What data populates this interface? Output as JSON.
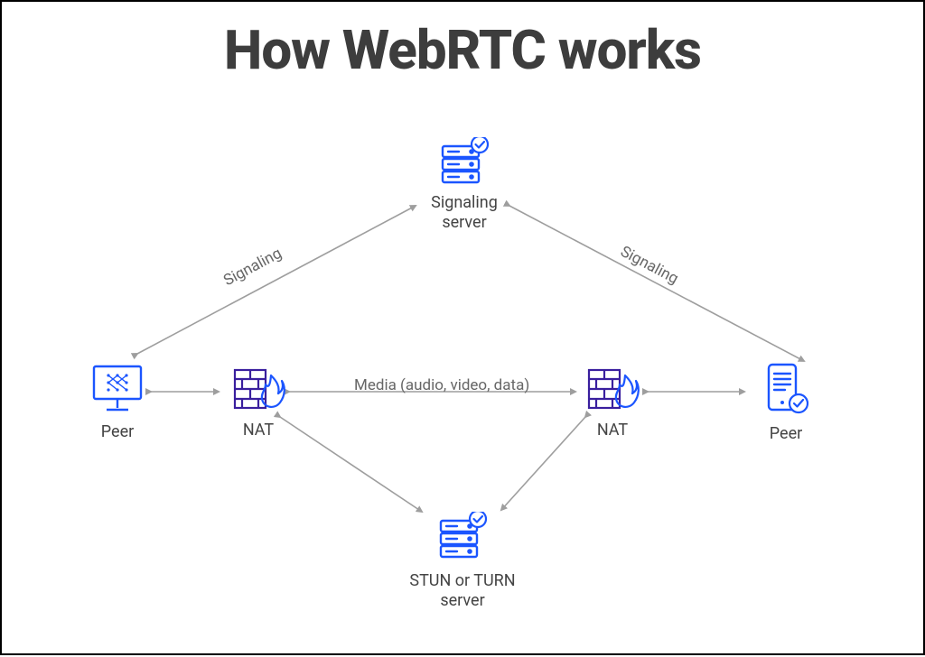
{
  "title": "How WebRTC works",
  "nodes": {
    "signaling_server": {
      "label": "Signaling server"
    },
    "peer_left": {
      "label": "Peer"
    },
    "nat_left": {
      "label": "NAT"
    },
    "nat_right": {
      "label": "NAT"
    },
    "peer_right": {
      "label": "Peer"
    },
    "stun_server": {
      "label": "STUN or TURN server"
    }
  },
  "edges": {
    "signaling_left": {
      "label": "Signaling"
    },
    "signaling_right": {
      "label": "Signaling"
    },
    "media": {
      "label": "Media (audio, video, data)"
    }
  },
  "colors": {
    "icon": "#1b55ff",
    "accent": "#3a1f9e",
    "arrow": "#9e9e9e",
    "title": "#3d3d3d"
  }
}
